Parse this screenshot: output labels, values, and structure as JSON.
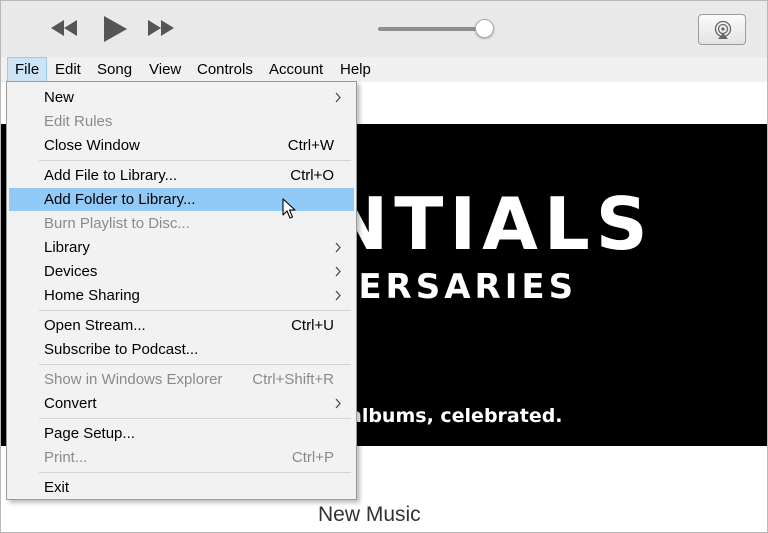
{
  "toolbar": {
    "volume_level": 0.92,
    "icons": [
      "rewind-icon",
      "play-icon",
      "fast-forward-icon",
      "airplay-icon"
    ]
  },
  "menubar": {
    "items": [
      "File",
      "Edit",
      "Song",
      "View",
      "Controls",
      "Account",
      "Help"
    ]
  },
  "file_menu": {
    "items": [
      {
        "label": "New",
        "shortcut": "",
        "submenu": true,
        "disabled": false
      },
      {
        "label": "Edit Rules",
        "shortcut": "",
        "submenu": false,
        "disabled": true
      },
      {
        "label": "Close Window",
        "shortcut": "Ctrl+W",
        "submenu": false,
        "disabled": false
      },
      {
        "label": "Add File to Library...",
        "shortcut": "Ctrl+O",
        "submenu": false,
        "disabled": false
      },
      {
        "label": "Add Folder to Library...",
        "shortcut": "",
        "submenu": false,
        "disabled": false,
        "highlighted": true
      },
      {
        "label": "Burn Playlist to Disc...",
        "shortcut": "",
        "submenu": false,
        "disabled": true
      },
      {
        "label": "Library",
        "shortcut": "",
        "submenu": true,
        "disabled": false
      },
      {
        "label": "Devices",
        "shortcut": "",
        "submenu": true,
        "disabled": false
      },
      {
        "label": "Home Sharing",
        "shortcut": "",
        "submenu": true,
        "disabled": false
      },
      {
        "label": "Open Stream...",
        "shortcut": "Ctrl+U",
        "submenu": false,
        "disabled": false
      },
      {
        "label": "Subscribe to Podcast...",
        "shortcut": "",
        "submenu": false,
        "disabled": false
      },
      {
        "label": "Show in Windows Explorer",
        "shortcut": "Ctrl+Shift+R",
        "submenu": false,
        "disabled": true
      },
      {
        "label": "Convert",
        "shortcut": "",
        "submenu": true,
        "disabled": false
      },
      {
        "label": "Page Setup...",
        "shortcut": "",
        "submenu": false,
        "disabled": false
      },
      {
        "label": "Print...",
        "shortcut": "Ctrl+P",
        "submenu": false,
        "disabled": true
      },
      {
        "label": "Exit",
        "shortcut": "",
        "submenu": false,
        "disabled": false
      }
    ]
  },
  "banner": {
    "title_fragment": "NTIALS",
    "subtitle_fragment": "VERSARIES",
    "tagline_fragment": "albums, celebrated."
  },
  "content": {
    "section_title": "New Music"
  },
  "colors": {
    "highlight": "#91c9f7",
    "active_menu": "#cde4f7",
    "banner_bg": "#000000"
  }
}
